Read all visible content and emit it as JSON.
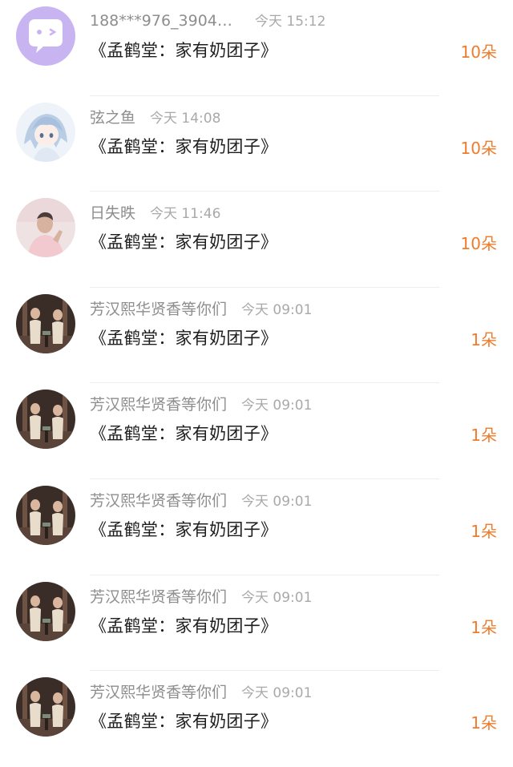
{
  "colors": {
    "accent": "#f07b2b",
    "name_text": "#8e8e8e",
    "time_text": "#a9a9a9"
  },
  "items": [
    {
      "name": "188***976_39048...",
      "time": "今天 15:12",
      "content": "《孟鹤堂：家有奶团子》",
      "count": "10朵",
      "avatar": "purple-chat-bubble-icon"
    },
    {
      "name": "弦之鱼",
      "time": "今天 14:08",
      "content": "《孟鹤堂：家有奶团子》",
      "count": "10朵",
      "avatar": "anime-girl-avatar"
    },
    {
      "name": "日失昳",
      "time": "今天 11:46",
      "content": "《孟鹤堂：家有奶团子》",
      "count": "10朵",
      "avatar": "person-photo-avatar"
    },
    {
      "name": "芳汉熙华贤香等你们",
      "time": "今天 09:01",
      "content": "《孟鹤堂：家有奶团子》",
      "count": "1朵",
      "avatar": "stage-duo-photo-avatar"
    },
    {
      "name": "芳汉熙华贤香等你们",
      "time": "今天 09:01",
      "content": "《孟鹤堂：家有奶团子》",
      "count": "1朵",
      "avatar": "stage-duo-photo-avatar"
    },
    {
      "name": "芳汉熙华贤香等你们",
      "time": "今天 09:01",
      "content": "《孟鹤堂：家有奶团子》",
      "count": "1朵",
      "avatar": "stage-duo-photo-avatar"
    },
    {
      "name": "芳汉熙华贤香等你们",
      "time": "今天 09:01",
      "content": "《孟鹤堂：家有奶团子》",
      "count": "1朵",
      "avatar": "stage-duo-photo-avatar"
    },
    {
      "name": "芳汉熙华贤香等你们",
      "time": "今天 09:01",
      "content": "《孟鹤堂：家有奶团子》",
      "count": "1朵",
      "avatar": "stage-duo-photo-avatar"
    }
  ]
}
